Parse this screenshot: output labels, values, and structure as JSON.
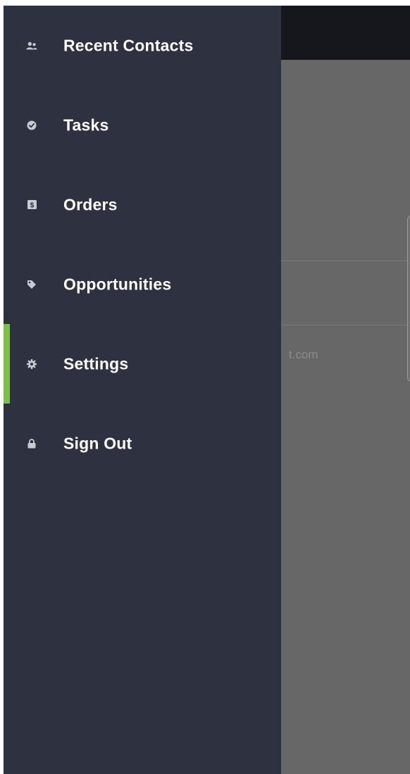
{
  "drawer": {
    "items": [
      {
        "label": "Recent Contacts",
        "icon": "contacts-icon",
        "active": false
      },
      {
        "label": "Tasks",
        "icon": "check-circle-icon",
        "active": false
      },
      {
        "label": "Orders",
        "icon": "dollar-box-icon",
        "active": false
      },
      {
        "label": "Opportunities",
        "icon": "tag-icon",
        "active": false
      },
      {
        "label": "Settings",
        "icon": "gear-icon",
        "active": true
      },
      {
        "label": "Sign Out",
        "icon": "lock-icon",
        "active": false
      }
    ],
    "accent_color": "#7cc242",
    "background_color": "#2e3140"
  },
  "background_app": {
    "visible_text": "t.com"
  }
}
